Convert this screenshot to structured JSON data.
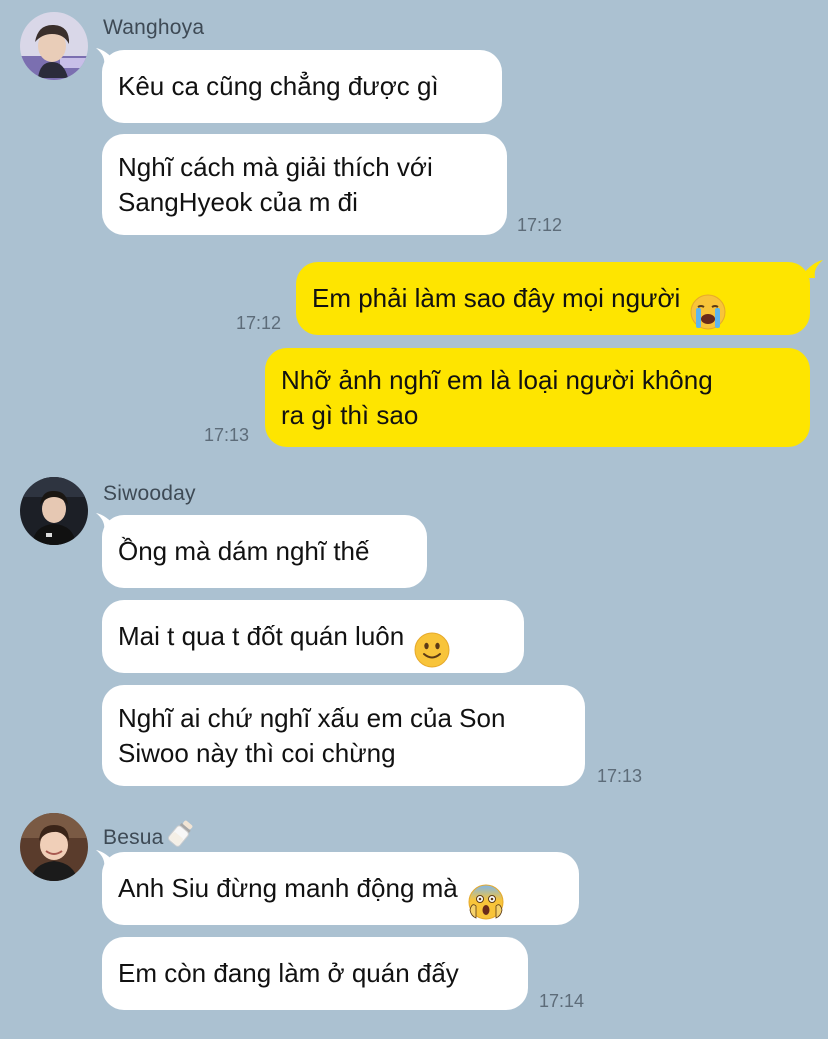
{
  "colors": {
    "background": "#abc1d1",
    "incoming_bubble": "#ffffff",
    "outgoing_bubble": "#fee500",
    "sender_name": "#3e4a55",
    "timestamp": "#5d6c79"
  },
  "messages": [
    {
      "sender": "Wanghoya",
      "avatar": "profile-photo-wanghoya",
      "bubbles": [
        "Kêu ca cũng chẳng được gì",
        "Nghĩ cách mà giải thích với\nSangHyeok của m đi"
      ],
      "time": "17:12"
    },
    {
      "sender": "me",
      "bubbles": [
        "Em phải làm sao đây mọi người"
      ],
      "emoji": "loudly-crying-face",
      "time": "17:12"
    },
    {
      "sender": "me",
      "bubbles": [
        "Nhỡ ảnh nghĩ em là loại người không\nra gì thì sao"
      ],
      "time": "17:13"
    },
    {
      "sender": "Siwooday",
      "avatar": "profile-photo-siwooday",
      "bubbles": [
        "Ồng mà dám nghĩ thế",
        "Mai t qua t đốt quán luôn",
        "Nghĩ ai chứ nghĩ xấu em của Son\nSiwoo này thì coi chừng"
      ],
      "emoji_bubble_2": "slightly-smiling-face",
      "time": "17:13"
    },
    {
      "sender": "Besua",
      "sender_badge": "baby-bottle-icon",
      "avatar": "profile-photo-besua",
      "bubbles": [
        "Anh Siu đừng manh động mà",
        "Em còn đang làm ở quán đấy"
      ],
      "emoji_bubble_1": "face-screaming-in-fear",
      "time": "17:14"
    }
  ]
}
